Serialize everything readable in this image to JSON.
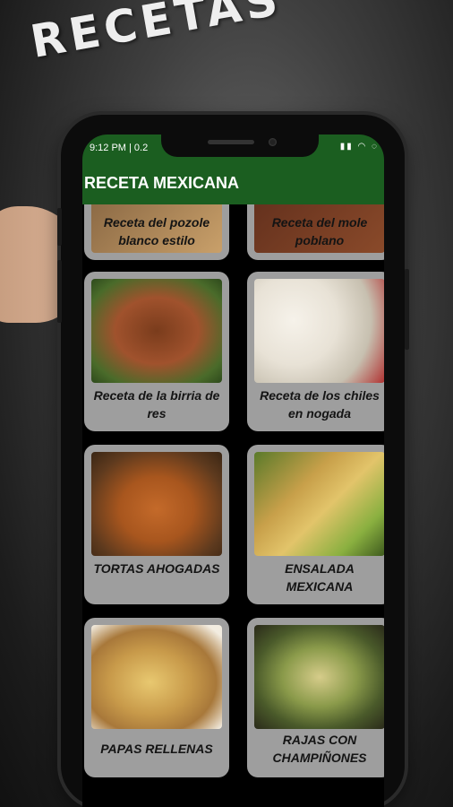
{
  "promo": {
    "title": "RECETAS"
  },
  "status_bar": {
    "time": "9:12 PM | 0.2",
    "icons": "▮▮ ◠ ◌"
  },
  "app_bar": {
    "title": "RECETA MEXICANA"
  },
  "recipes": [
    {
      "label": "Receta del pozole blanco estilo",
      "image": "pozole-image"
    },
    {
      "label": "Receta del mole poblano",
      "image": "mole-image"
    },
    {
      "label": "Receta de la birria de res",
      "image": "birria-image"
    },
    {
      "label": "Receta de los chiles en nogada",
      "image": "chiles-image"
    },
    {
      "label": "TORTAS AHOGADAS",
      "image": "tortas-image"
    },
    {
      "label": "ENSALADA MEXICANA",
      "image": "ensalada-image"
    },
    {
      "label": "PAPAS RELLENAS",
      "image": "papas-image"
    },
    {
      "label": "RAJAS CON CHAMPIÑONES",
      "image": "rajas-image"
    }
  ],
  "colors": {
    "app_bar": "#1b5e20",
    "card": "#9e9e9e"
  }
}
